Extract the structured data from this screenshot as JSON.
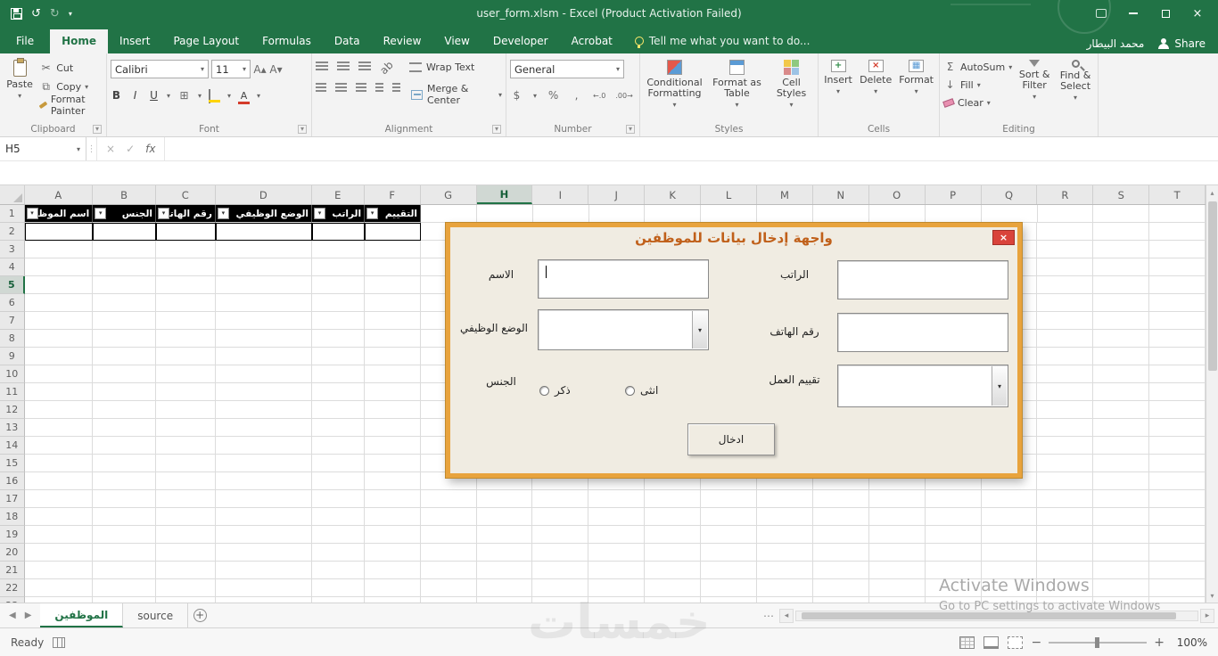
{
  "title_bar": {
    "title": "user_form.xlsm - Excel (Product Activation Failed)"
  },
  "icons": {
    "dropdown": "▾",
    "undo": "↺",
    "redo": "↻",
    "close": "×",
    "check": "✓",
    "cancel": "×",
    "fx": "fx",
    "cut": "✂",
    "copy": "⧉",
    "sigma": "Σ",
    "fill_down": "↓",
    "scroll_left": "◂",
    "scroll_right": "▸",
    "scroll_up": "▴",
    "scroll_down": "▾",
    "nav_left": "◀",
    "nav_right": "▶",
    "plus": "+",
    "dots": "⋯",
    "font_up": "A▴",
    "font_down": "A▾",
    "borders": "⊞",
    "currency": "$",
    "percent": "%",
    "comma": ",",
    "dec_inc": "←.0",
    "dec_dec": ".00→"
  },
  "ribbon_tabs": {
    "file": "File",
    "home": "Home",
    "insert": "Insert",
    "page_layout": "Page Layout",
    "formulas": "Formulas",
    "data": "Data",
    "review": "Review",
    "view": "View",
    "developer": "Developer",
    "acrobat": "Acrobat",
    "tell_me": "Tell me what you want to do...",
    "user": "محمد البيطار",
    "share": "Share"
  },
  "ribbon": {
    "clipboard": {
      "label": "Clipboard",
      "paste": "Paste",
      "cut": "Cut",
      "copy": "Copy",
      "format_painter": "Format Painter"
    },
    "font": {
      "label": "Font",
      "font_name": "Calibri",
      "font_size": "11",
      "bold": "B",
      "italic": "I",
      "underline": "U",
      "color_letter": "A"
    },
    "alignment": {
      "label": "Alignment",
      "wrap_text": "Wrap Text",
      "merge_center": "Merge & Center"
    },
    "number": {
      "label": "Number",
      "format": "General"
    },
    "styles": {
      "label": "Styles",
      "conditional_l1": "Conditional",
      "conditional_l2": "Formatting",
      "table_l1": "Format as",
      "table_l2": "Table",
      "cellstyles_l1": "Cell",
      "cellstyles_l2": "Styles"
    },
    "cells": {
      "label": "Cells",
      "insert": "Insert",
      "delete": "Delete",
      "format": "Format"
    },
    "editing": {
      "label": "Editing",
      "autosum": "AutoSum",
      "fill": "Fill",
      "clear": "Clear",
      "sort_l1": "Sort &",
      "sort_l2": "Filter",
      "find_l1": "Find &",
      "find_l2": "Select"
    }
  },
  "formula_bar": {
    "name_box": "H5"
  },
  "grid": {
    "columns": [
      "A",
      "B",
      "C",
      "D",
      "E",
      "F",
      "G",
      "H",
      "I",
      "J",
      "K",
      "L",
      "M",
      "N",
      "O",
      "P",
      "Q",
      "R",
      "S",
      "T"
    ],
    "rows": 22,
    "selected_column": "H",
    "selected_row": 5,
    "header_cells": [
      {
        "col": "A",
        "label": "اسم الموظف"
      },
      {
        "col": "B",
        "label": "الجنس"
      },
      {
        "col": "C",
        "label": "رقم الهاتف"
      },
      {
        "col": "D",
        "label": "الوضع الوظيفي"
      },
      {
        "col": "E",
        "label": "الراتب"
      },
      {
        "col": "F",
        "label": "التقييم"
      }
    ]
  },
  "form": {
    "title": "واجهة إدخال بيانات للموظفين",
    "name_label": "الاسم",
    "salary_label": "الراتب",
    "job_label": "الوضع الوظيفي",
    "phone_label": "رقم الهاتف",
    "gender_label": "الجنس",
    "male_label": "ذكر",
    "female_label": "انثى",
    "rating_label": "تقييم العمل",
    "submit_label": "ادخال",
    "name_value": "",
    "salary_value": "",
    "phone_value": "",
    "job_value": "",
    "rating_value": ""
  },
  "sheet_tabs": {
    "tab1": "الموظفين",
    "tab2": "source"
  },
  "status_bar": {
    "ready": "Ready",
    "zoom": "100%"
  },
  "watermark": {
    "line1": "Activate Windows",
    "line2": "Go to PC settings to activate Windows",
    "brand": "خمسات"
  }
}
